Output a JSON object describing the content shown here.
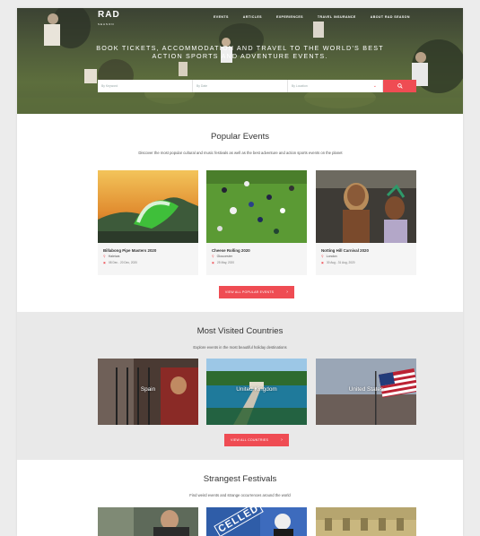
{
  "brand": {
    "logo": "RAD",
    "tagline": "SEASON"
  },
  "nav": [
    "EVENTS",
    "ARTICLES",
    "EXPERIENCES",
    "TRAVEL INSURANCE",
    "ABOUT RAD SEASON"
  ],
  "hero": {
    "title": "BOOK TICKETS, ACCOMMODATION AND TRAVEL TO THE WORLD'S BEST ACTION SPORTS AND ADVENTURE EVENTS."
  },
  "search": {
    "keyword_placeholder": "By Keyword",
    "date_placeholder": "By Date",
    "location_placeholder": "By Location",
    "chevron": "⌄",
    "button_icon": "search-icon"
  },
  "popular": {
    "title": "Popular Events",
    "subtitle": "Discover the most popular cultural and music festivals as well as the best adventure and action sports events on the planet",
    "cards": [
      {
        "name": "Billabong Pipe Masters 2020",
        "location": "Haleiwa",
        "date": "08 Dec - 20 Dec, 2020"
      },
      {
        "name": "Cheese Rolling 2020",
        "location": "Gloucester",
        "date": "25 May, 2020"
      },
      {
        "name": "Notting Hill Carnival 2020",
        "location": "London",
        "date": "30 Aug - 31 Aug, 2020"
      }
    ],
    "cta": "VIEW ALL POPULAR EVENTS"
  },
  "countries": {
    "title": "Most Visited Countries",
    "subtitle": "Explore events in the most beautiful holiday destinations",
    "items": [
      "Spain",
      "United Kingdom",
      "United States"
    ],
    "cta": "VIEW ALL COUNTRIES"
  },
  "strangest": {
    "title": "Strangest Festivals",
    "subtitle": "Find weird events and strange occurrences around the world",
    "stamp": "CELLED"
  },
  "colors": {
    "accent": "#ef4c53"
  }
}
